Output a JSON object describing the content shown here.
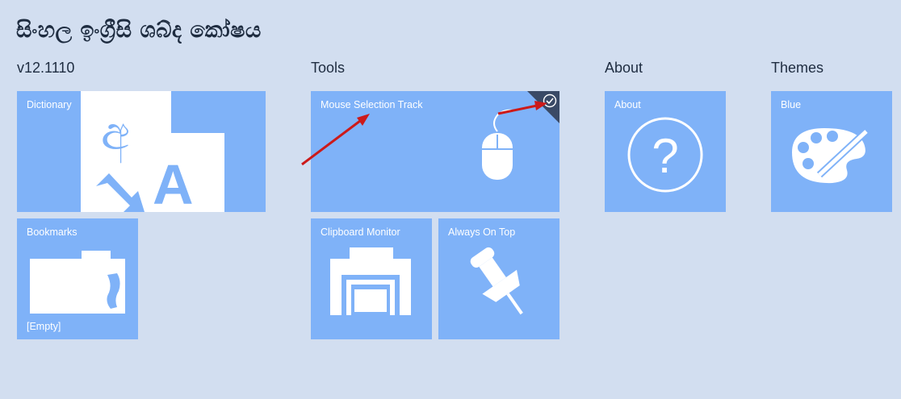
{
  "app": {
    "title": "සිංහල ඉංග්‍රීසි ශබ්ද කෝෂය"
  },
  "sections": {
    "version": "v12.1110",
    "tools": "Tools",
    "about": "About",
    "themes": "Themes"
  },
  "tiles": {
    "dictionary": {
      "label": "Dictionary",
      "glyph_letters": "අ",
      "glyph_latin": "A",
      "icon": "dictionary-icon"
    },
    "bookmarks": {
      "label": "Bookmarks",
      "sub": "[Empty]",
      "icon": "folder-icon"
    },
    "mouse_selection_track": {
      "label": "Mouse Selection Track",
      "checked": true,
      "icon": "mouse-icon"
    },
    "clipboard_monitor": {
      "label": "Clipboard Monitor",
      "icon": "clipboard-icon"
    },
    "always_on_top": {
      "label": "Always On Top",
      "icon": "pushpin-icon"
    },
    "about": {
      "label": "About",
      "glyph": "?",
      "icon": "help-icon"
    },
    "blue": {
      "label": "Blue",
      "icon": "palette-icon"
    }
  },
  "colors": {
    "background": "#d2def0",
    "tile": "#7fb2f8",
    "corner_flag": "#3a4a66",
    "annotation_arrow": "#cc1a1a"
  }
}
